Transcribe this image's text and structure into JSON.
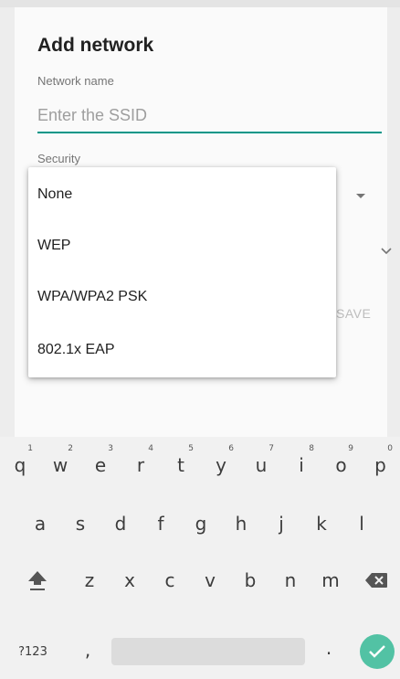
{
  "dialog": {
    "title": "Add network",
    "network_name_label": "Network name",
    "ssid_placeholder": "Enter the SSID",
    "ssid_value": "",
    "security_label": "Security",
    "save_label": "SAVE"
  },
  "security_menu": {
    "options": [
      "None",
      "WEP",
      "WPA/WPA2 PSK",
      "802.1x EAP"
    ]
  },
  "keyboard": {
    "row1": [
      "q",
      "w",
      "e",
      "r",
      "t",
      "y",
      "u",
      "i",
      "o",
      "p"
    ],
    "row1_hints": [
      "1",
      "2",
      "3",
      "4",
      "5",
      "6",
      "7",
      "8",
      "9",
      "0"
    ],
    "row2": [
      "a",
      "s",
      "d",
      "f",
      "g",
      "h",
      "j",
      "k",
      "l"
    ],
    "row3": [
      "z",
      "x",
      "c",
      "v",
      "b",
      "n",
      "m"
    ],
    "symbols_label": "?123",
    "comma": ",",
    "period": ".",
    "colors": {
      "accent": "#009688",
      "enter": "#52c2a4"
    }
  }
}
